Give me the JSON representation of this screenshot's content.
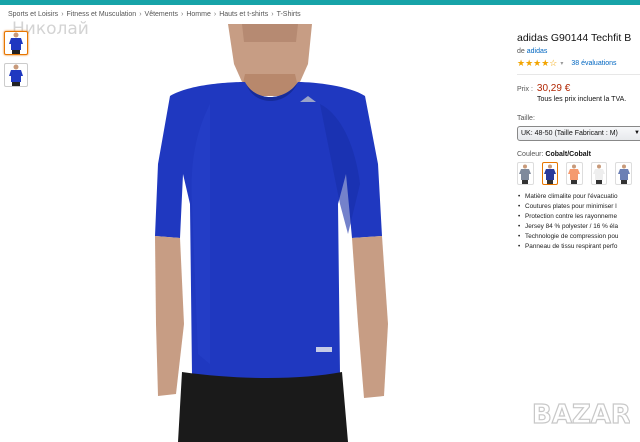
{
  "breadcrumb": [
    "Sports et Loisirs",
    "Fitness et Musculation",
    "Vêtements",
    "Homme",
    "Hauts et t-shirts",
    "T-Shirts"
  ],
  "breadcrumb_separator": "›",
  "watermark_top": "Николай",
  "watermark_bottom": "BAZAR",
  "product": {
    "title": "adidas G90144 Techfit B",
    "brand_prefix": "de",
    "brand": "adidas",
    "rating_stars": "★★★★☆",
    "rating_value": 4.5,
    "reviews": "38 évaluations",
    "price_label": "Prix :",
    "price": "30,29 €",
    "tva_note": "Tous les prix incluent la TVA."
  },
  "size": {
    "label": "Taille:",
    "selected": "UK: 48-50 (Taille Fabricant : M)"
  },
  "color": {
    "label": "Couleur:",
    "selected": "Cobalt/Cobalt",
    "swatches": [
      "#7f8a9c",
      "#2a3a9c",
      "#f59a6e",
      "#eeeeee",
      "#6b7fb5"
    ]
  },
  "bullets": [
    "Matière climalite pour l'évacuatio",
    "Coutures plates pour minimiser l",
    "Protection contre les rayonneme",
    "Jersey 84 % polyester / 16 % éla",
    "Technologie de compression pou",
    "Panneau de tissu respirant perfo"
  ],
  "colors": {
    "accent": "#17a3a8",
    "shirt": "#1f38c0",
    "price": "#b12704",
    "link": "#0066c0",
    "star": "#f2a400"
  }
}
